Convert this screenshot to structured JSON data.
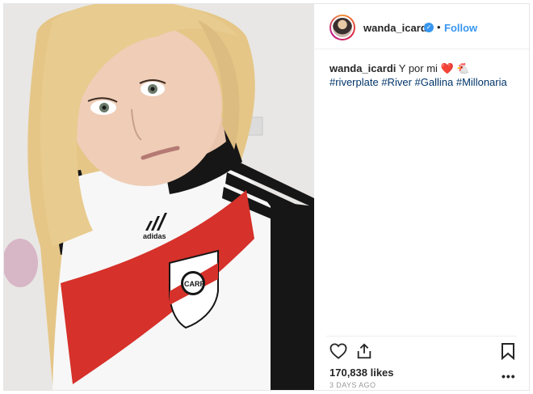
{
  "post": {
    "author": {
      "username": "wanda_icardi",
      "verified_icon": "verified-badge-icon",
      "separator": "•",
      "follow_label": "Follow"
    },
    "caption": {
      "username": "wanda_icardi",
      "text": "Y por mi ❤️ 🐔",
      "hashtags": [
        "#riverplate",
        "#River",
        "#Gallina",
        "#Millonaria"
      ]
    },
    "likes": "170,838 likes",
    "timestamp": "3 DAYS AGO",
    "more_label": "•••",
    "photo_crest_text": "CARP"
  },
  "colors": {
    "link_blue": "#3897f0",
    "hashtag_blue": "#003569",
    "jersey_red": "#d6312a",
    "jersey_black": "#161616"
  },
  "icons": [
    "heart-icon",
    "share-icon",
    "bookmark-icon"
  ]
}
